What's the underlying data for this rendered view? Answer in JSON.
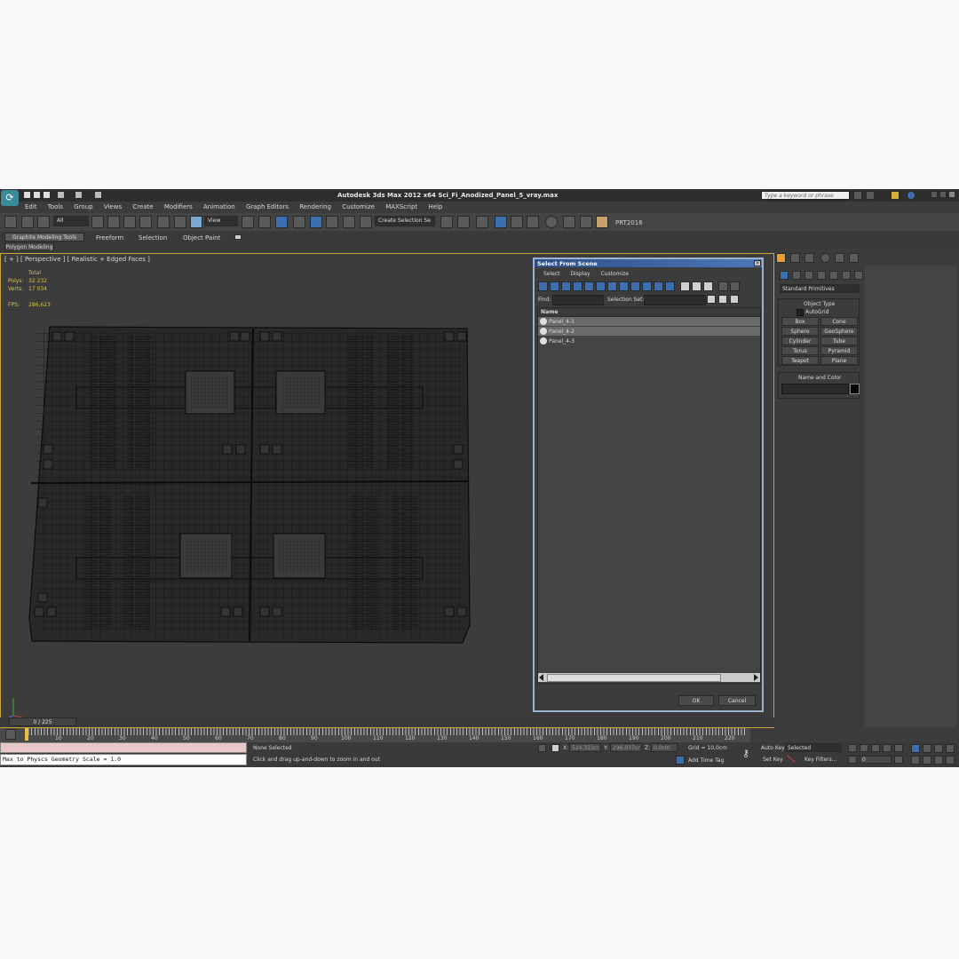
{
  "title": "Autodesk 3ds Max  2012 x64    Sci_Fi_Anodized_Panel_5_vray.max",
  "search_placeholder": "Type a keyword or phrase",
  "menu": [
    "Edit",
    "Tools",
    "Group",
    "Views",
    "Create",
    "Modifiers",
    "Animation",
    "Graph Editors",
    "Rendering",
    "Customize",
    "MAXScript",
    "Help"
  ],
  "toolbar": {
    "filter": "All",
    "refcoord": "View",
    "named_sel": "Create Selection Se",
    "prt": "PRT2016"
  },
  "ribbon_tabs": [
    "Graphite Modeling Tools",
    "Freeform",
    "Selection",
    "Object Paint"
  ],
  "ribbon_sub": "Polygon Modeling",
  "viewport": {
    "label": "[ + ] [ Perspective ] [ Realistic + Edged Faces ]",
    "stats": {
      "total": "Total",
      "polys_label": "Polys:",
      "polys": "32 232",
      "verts_label": "Verts:",
      "verts": "17 034",
      "fps_label": "FPS:",
      "fps": "286,623"
    }
  },
  "dialog": {
    "title": "Select From Scene",
    "menu": [
      "Select",
      "Display",
      "Customize"
    ],
    "find_label": "Find:",
    "selset_label": "Selection Set:",
    "column": "Name",
    "items": [
      "Panel_4-1",
      "Panel_4-2",
      "Panel_4-3"
    ],
    "ok": "OK",
    "cancel": "Cancel"
  },
  "command_panel": {
    "dropdown": "Standard Primitives",
    "object_type": "Object Type",
    "autogrid": "AutoGrid",
    "buttons": [
      "Box",
      "Cone",
      "Sphere",
      "GeoSphere",
      "Cylinder",
      "Tube",
      "Torus",
      "Pyramid",
      "Teapot",
      "Plane"
    ],
    "name_color": "Name and Color"
  },
  "timeline": {
    "frame": "0 / 225",
    "ticks": [
      "10",
      "20",
      "30",
      "40",
      "50",
      "60",
      "70",
      "80",
      "90",
      "100",
      "110",
      "120",
      "130",
      "140",
      "150",
      "160",
      "170",
      "180",
      "190",
      "200",
      "210",
      "220"
    ]
  },
  "status": {
    "maxscript": "Max to Physcs Geometry Scale = 1.0",
    "selection": "None Selected",
    "prompt": "Click and drag up-and-down to zoom in and out",
    "x_label": "X:",
    "x": "524,322cr",
    "y_label": "Y:",
    "y": "296,037cr",
    "z_label": "Z:",
    "z": "0,0cm",
    "grid": "Grid = 10,0cm",
    "add_time_tag": "Add Time Tag",
    "auto_key": "Auto Key",
    "set_key": "Set Key",
    "selected": "Selected",
    "key_filters": "Key Filters...",
    "frame_field": "0"
  }
}
